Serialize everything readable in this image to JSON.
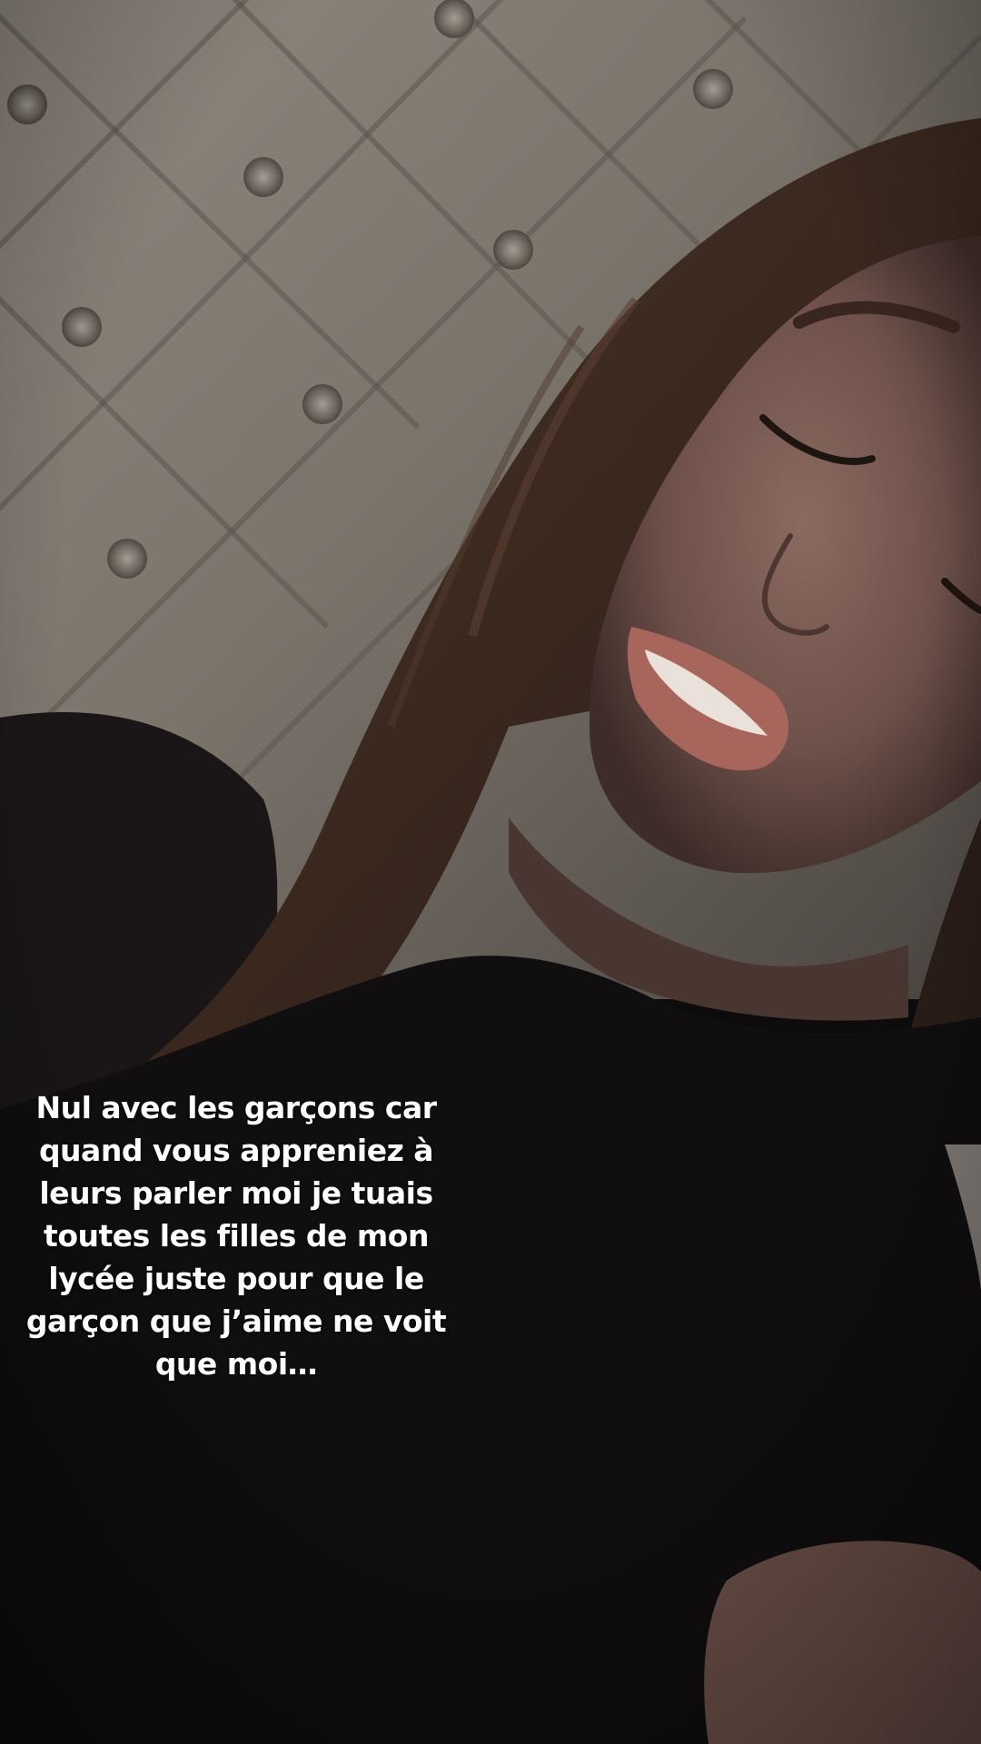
{
  "story": {
    "caption_lines": [
      "Nul avec les garçons car",
      "quand vous appreniez à",
      "leurs parler moi je tuais",
      "toutes les filles de mon",
      "lycée juste pour que le",
      "garçon que j’aime ne voit",
      "que moi…"
    ]
  },
  "colors": {
    "headboard": "#8a847b",
    "headboard_shadow": "#5e5952",
    "hair": "#3a2a22",
    "skin": "#7a5a52",
    "lips": "#b06c62",
    "shirt": "#0f0d0e",
    "caption_text": "#ffffff"
  },
  "scene": {
    "elements": [
      "tufted-headboard",
      "long-brown-hair",
      "face-smiling-eyes-closed",
      "black-t-shirt",
      "hand-bottom-right"
    ]
  }
}
